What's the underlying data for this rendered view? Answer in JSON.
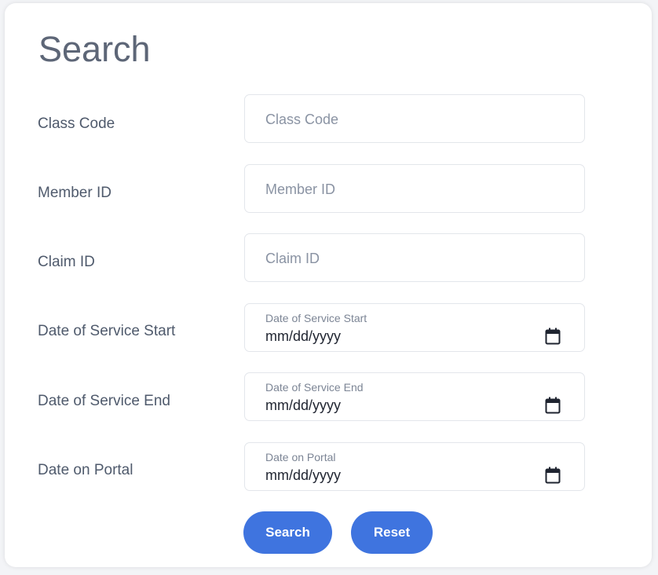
{
  "form": {
    "title": "Search",
    "fields": [
      {
        "label": "Class Code",
        "placeholder": "Class Code"
      },
      {
        "label": "Member ID",
        "placeholder": "Member ID"
      },
      {
        "label": "Claim ID",
        "placeholder": "Claim ID"
      },
      {
        "label": "Date of Service Start",
        "float_label": "Date of Service Start",
        "value": "mm/dd/yyyy"
      },
      {
        "label": "Date of Service End",
        "float_label": "Date of Service End",
        "value": "mm/dd/yyyy"
      },
      {
        "label": "Date on Portal",
        "float_label": "Date on Portal",
        "value": "mm/dd/yyyy"
      }
    ],
    "buttons": {
      "search": "Search",
      "reset": "Reset"
    }
  },
  "colors": {
    "primary_button": "#3f74df",
    "title_text": "#5d6677"
  },
  "icons": {
    "date_picker": "calendar-icon"
  }
}
